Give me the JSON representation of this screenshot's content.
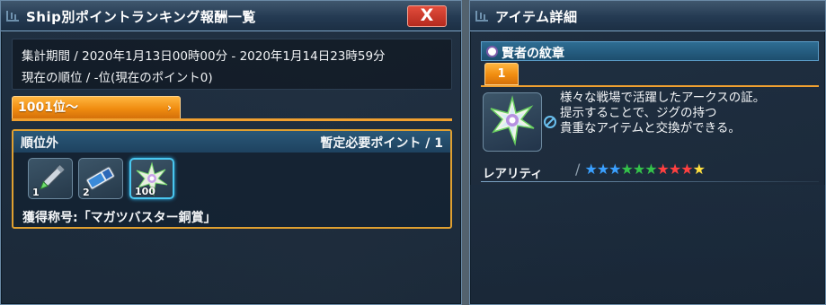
{
  "ranking_window": {
    "title": "Ship別ポイントランキング報酬一覧",
    "close_label": "X",
    "period_text": "集計期間 / 2020年1月13日00時00分 - 2020年1月14日23時59分",
    "current_rank_text": "現在の順位 / -位(現在のポイント0)",
    "rank_tab": {
      "label": "1001位～",
      "arrow": "›"
    },
    "reward": {
      "rank_label": "順位外",
      "required_points": "暫定必要ポイント / 1",
      "items": [
        {
          "count": "1",
          "icon": "pencil-icon"
        },
        {
          "count": "2",
          "icon": "ticket-icon"
        },
        {
          "count": "100",
          "icon": "emblem-star-icon",
          "selected": true
        }
      ],
      "title_obtained": "獲得称号:「マガツバスター銅賞」"
    }
  },
  "item_detail_window": {
    "title": "アイテム詳細",
    "item_name": "賢者の紋章",
    "tab_number": "1",
    "description": "様々な戦場で活躍したアークスの証。\n提示することで、ジグの持つ\n貴重なアイテムと交換ができる。",
    "rarity_label": "レアリティ",
    "rarity_separator": "/",
    "rarity_stars": 10,
    "rarity_star_colors": [
      "#3aa0ff",
      "#3aa0ff",
      "#3aa0ff",
      "#34c24a",
      "#34c24a",
      "#34c24a",
      "#ff4040",
      "#ff4040",
      "#ff4040",
      "#ffe040"
    ]
  },
  "colors": {
    "accent_orange": "#f08c10",
    "selection_cyan": "#49c7f0",
    "close_red": "#c83426"
  }
}
